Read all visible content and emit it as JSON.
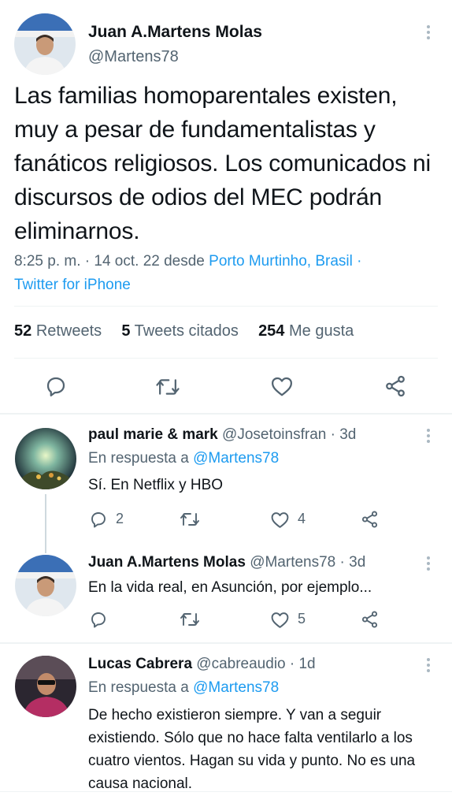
{
  "main_tweet": {
    "author_name": "Juan A.Martens Molas",
    "author_handle": "@Martens78",
    "text": "Las familias homoparentales existen, muy a pesar de fundamentalistas y fanáticos religiosos. Los comunicados ni discursos de odios del MEC podrán eliminarnos.",
    "time": "8:25 p. m. · 14 oct. 22 desde ",
    "location": "Porto Murtinho, Brasil",
    "sep": " ·",
    "source": "Twitter for iPhone",
    "stats": {
      "retweets_count": "52",
      "retweets_label": "Retweets",
      "quotes_count": "5",
      "quotes_label": "Tweets citados",
      "likes_count": "254",
      "likes_label": "Me gusta"
    },
    "icons": [
      "reply-icon",
      "retweet-icon",
      "like-icon",
      "share-icon"
    ]
  },
  "replies": [
    {
      "author_name": "paul marie & mark",
      "author_handle": "@Josetoinsfran",
      "time": " · 3d",
      "reply_to_prefix": "En respuesta a ",
      "reply_to_handle": "@Martens78",
      "text": "Sí. En Netflix y HBO",
      "reply_count": "2",
      "retweet_count": "",
      "like_count": "4"
    },
    {
      "author_name": "Juan A.Martens Molas",
      "author_handle": "@Martens78",
      "time": " · 3d",
      "text": "En la vida real, en Asunción, por ejemplo...",
      "reply_count": "",
      "retweet_count": "",
      "like_count": "5"
    },
    {
      "author_name": "Lucas Cabrera",
      "author_handle": "@cabreaudio",
      "time": " · 1d",
      "reply_to_prefix": "En respuesta a ",
      "reply_to_handle": "@Martens78",
      "text": "De hecho existieron siempre. Y van a seguir existiendo. Sólo que no hace falta ventilarlo a los cuatro vientos. Hagan su vida y punto. No es una causa nacional."
    }
  ],
  "colors": {
    "link": "#1d9bf0",
    "muted": "#536471",
    "text": "#0f1419"
  }
}
